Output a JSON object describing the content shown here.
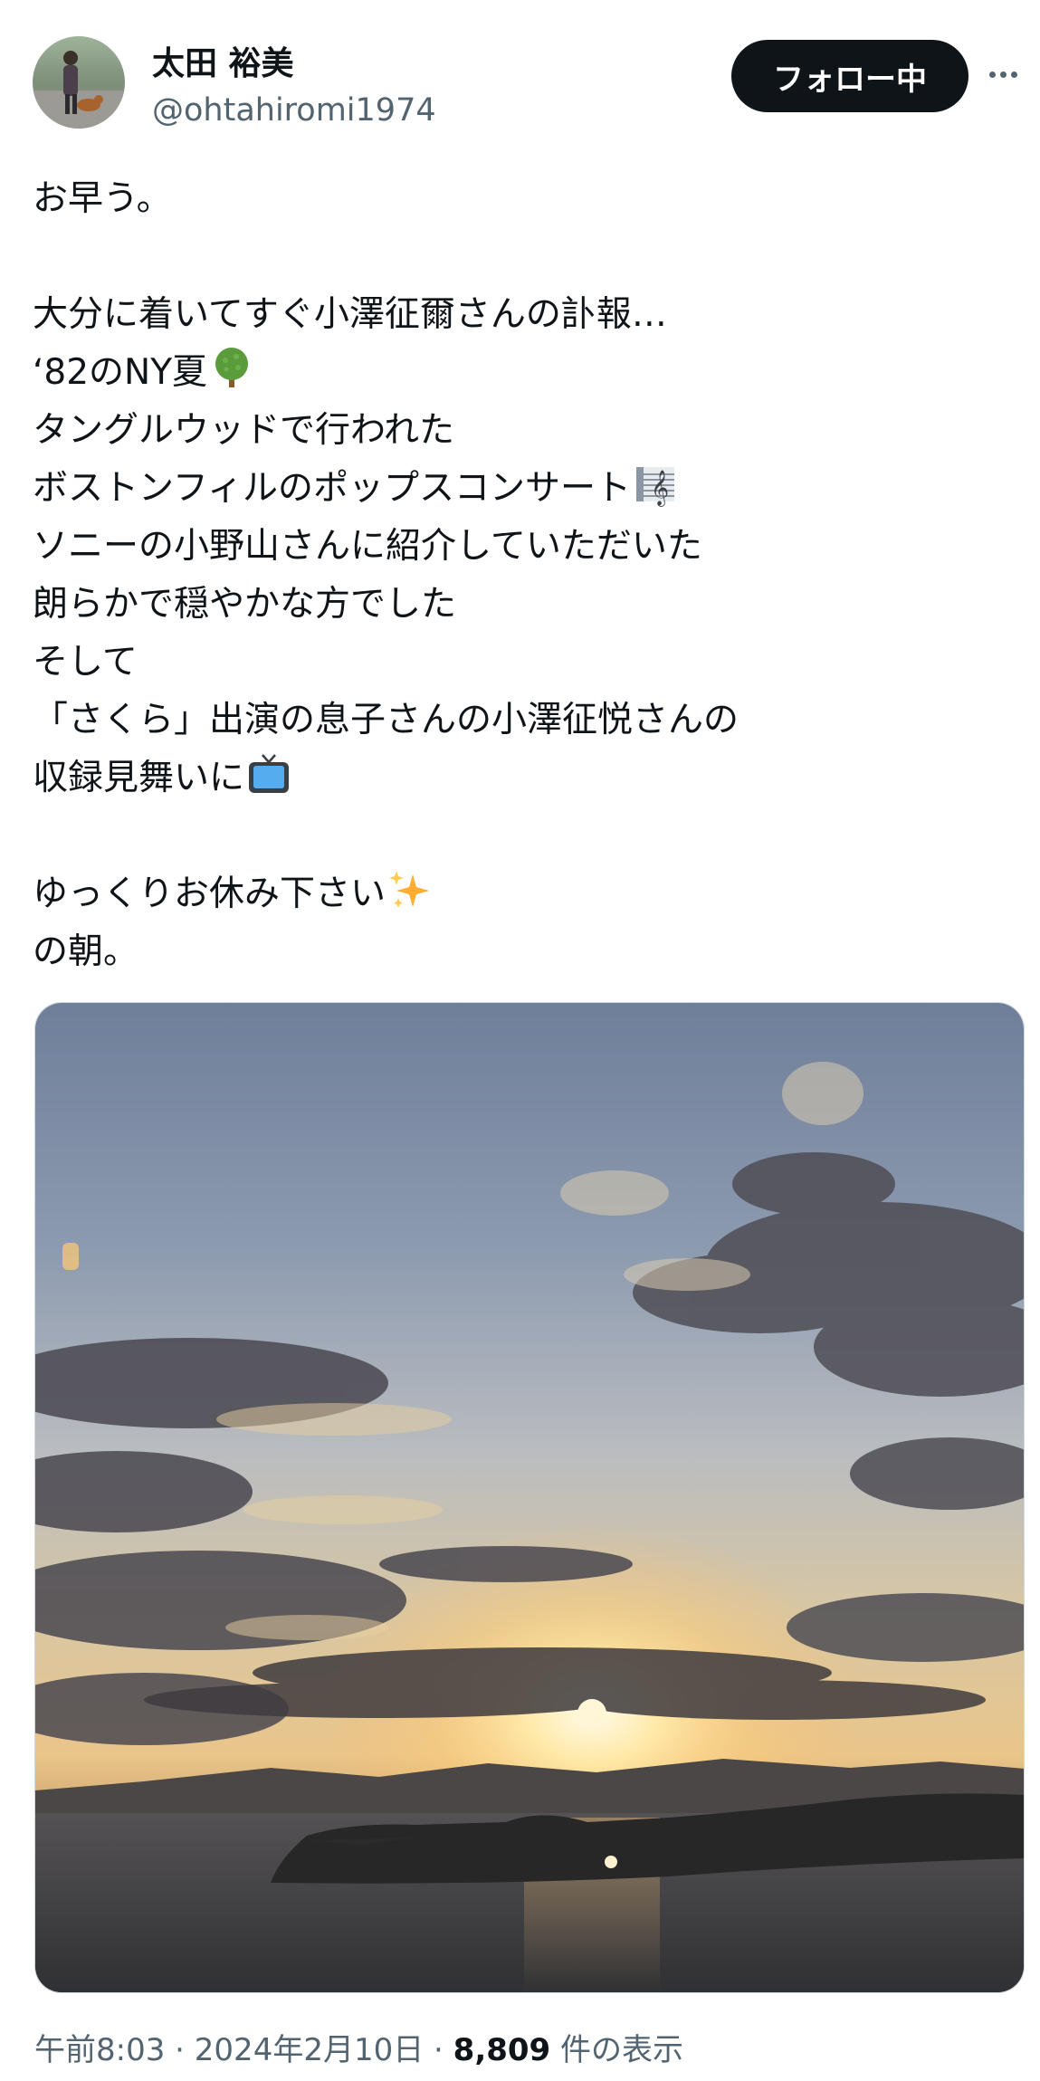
{
  "author": {
    "display_name": "太田 裕美",
    "handle": "@ohtahiromi1974",
    "follow_label": "フォロー中"
  },
  "tweet": {
    "lines": [
      "お早う。",
      "",
      "大分に着いてすぐ小澤征爾さんの訃報…",
      "‘82のNY夏",
      "タングルウッドで行われた",
      "ボストンフィルのポップスコンサート",
      "ソニーの小野山さんに紹介していただいた",
      "朗らかで穏やかな方でした",
      "そして",
      "「さくら」出演の息子さんの小澤征悦さんの",
      "収録見舞いに",
      "",
      "ゆっくりお休み下さい",
      "の朝。"
    ],
    "emojis": {
      "tree": "tree-icon",
      "music": "musical-score-icon",
      "tv": "television-icon",
      "sparkles": "sparkles-icon"
    }
  },
  "media": {
    "type": "photo"
  },
  "meta": {
    "time": "午前8:03",
    "separator": " · ",
    "date": "2024年2月10日",
    "views": "8,809",
    "views_suffix": " 件の表示"
  }
}
